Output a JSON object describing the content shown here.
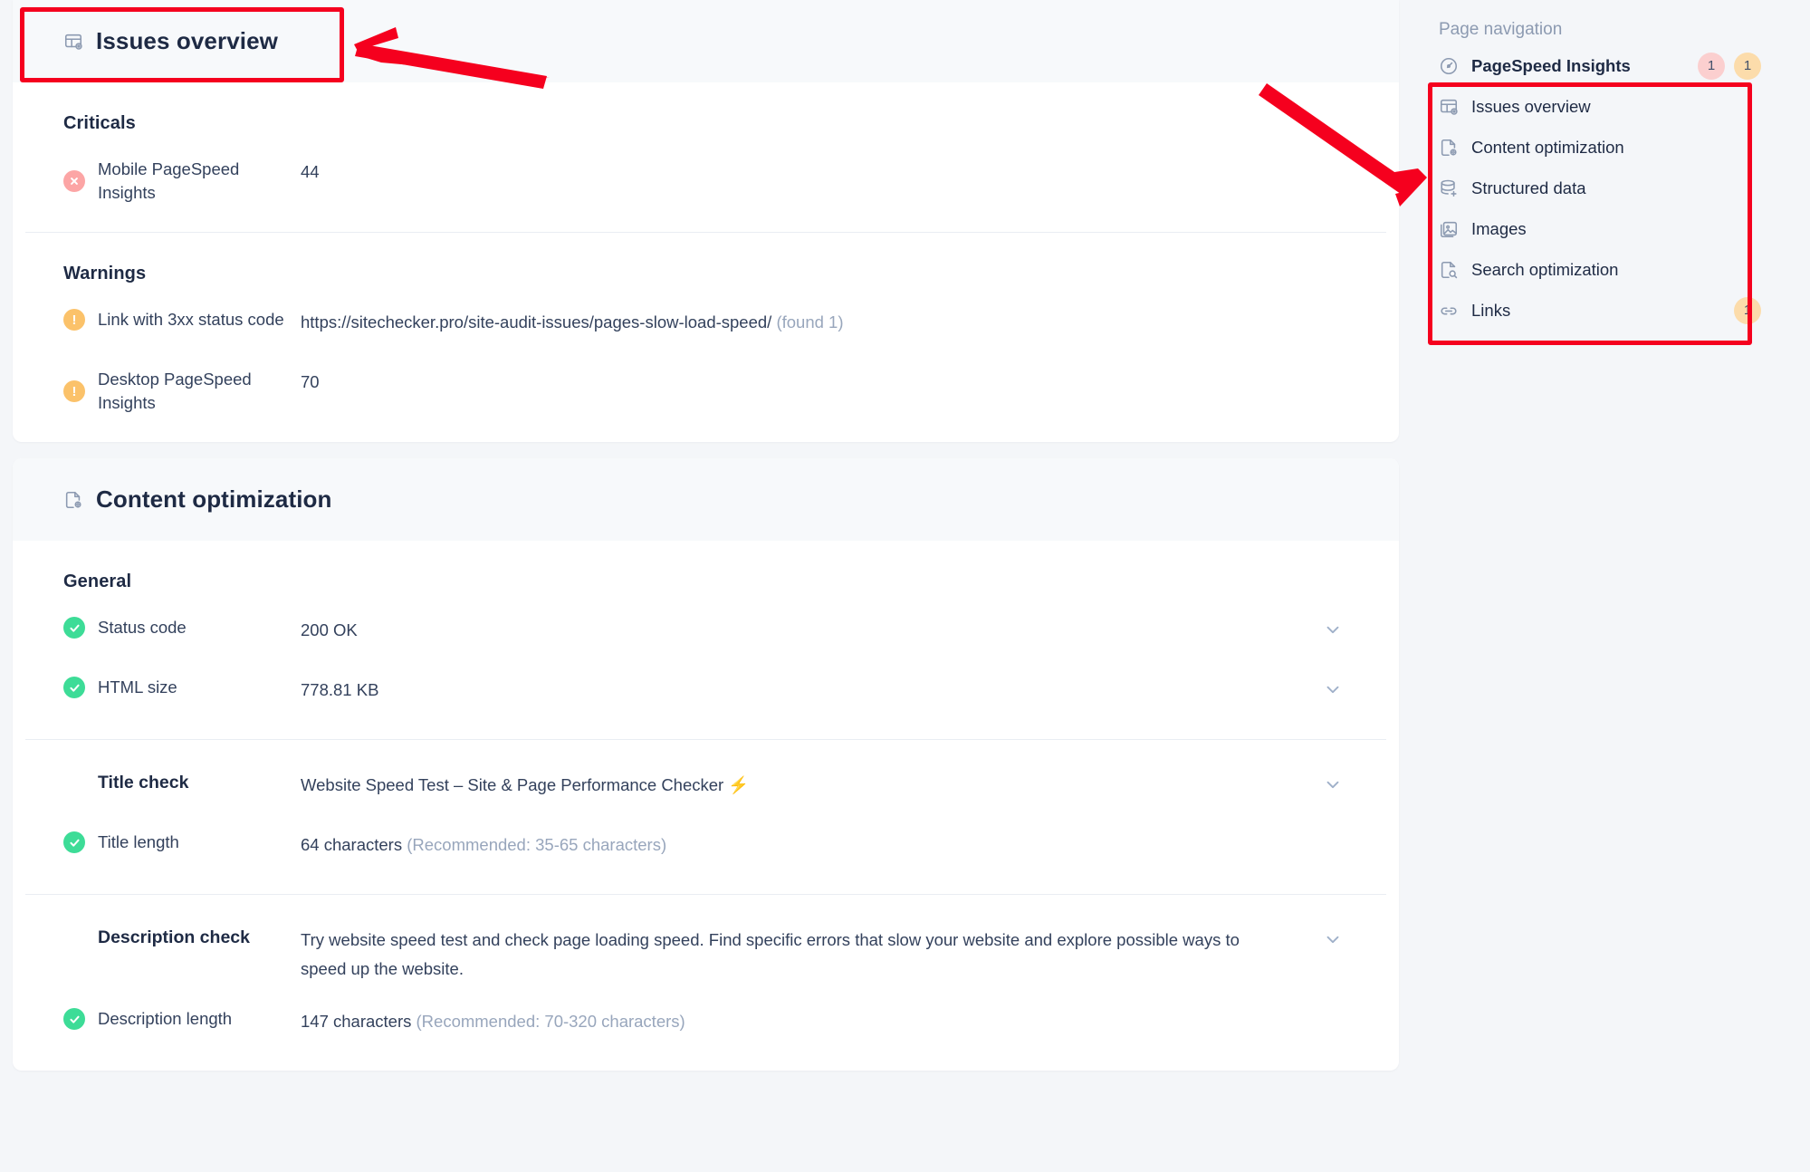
{
  "sections": [
    {
      "id": "issues-overview",
      "title": "Issues overview",
      "icon": "issues-overview-icon",
      "groups": [
        {
          "title": "Criticals",
          "rows": [
            {
              "status": "critical",
              "label": "Mobile PageSpeed Insights",
              "value": "44",
              "chevron": false
            }
          ]
        },
        {
          "title": "Warnings",
          "rows": [
            {
              "status": "warning",
              "label": "Link with 3xx status code",
              "value": "https://sitechecker.pro/site-audit-issues/pages-slow-load-speed/",
              "value_kind": "link",
              "suffix": "(found 1)",
              "chevron": false
            },
            {
              "status": "warning",
              "label": "Desktop PageSpeed Insights",
              "value": "70",
              "chevron": false
            }
          ]
        }
      ]
    },
    {
      "id": "content-optimization",
      "title": "Content optimization",
      "icon": "content-optimization-icon",
      "groups": [
        {
          "title": "General",
          "rows": [
            {
              "status": "ok",
              "label": "Status code",
              "value": "200 OK",
              "value_kind": "green",
              "chevron": true
            },
            {
              "status": "ok",
              "label": "HTML size",
              "value": "778.81 KB",
              "chevron": true
            }
          ]
        },
        {
          "title": null,
          "rows": [
            {
              "status": "none",
              "label": "Title check",
              "label_bold": true,
              "value": "Website Speed Test – Site & Page Performance Checker ⚡",
              "chevron": true
            },
            {
              "status": "ok",
              "label": "Title length",
              "value": "64 characters",
              "suffix": "(Recommended: 35-65 characters)",
              "chevron": false
            }
          ]
        },
        {
          "title": null,
          "rows": [
            {
              "status": "none",
              "label": "Description check",
              "label_bold": true,
              "value": "Try website speed test and check page loading speed. Find specific errors that slow your website and explore possible ways to speed up the website.",
              "chevron": true
            },
            {
              "status": "ok",
              "label": "Description length",
              "value": "147 characters",
              "suffix": "(Recommended: 70-320 characters)",
              "chevron": false
            }
          ]
        }
      ]
    }
  ],
  "sidebar": {
    "title": "Page navigation",
    "items": [
      {
        "label": "PageSpeed Insights",
        "icon": "speedometer-icon",
        "badges": [
          {
            "value": "1",
            "tone": "red"
          },
          {
            "value": "1",
            "tone": "amber"
          }
        ],
        "is_head": true
      },
      {
        "label": "Issues overview",
        "icon": "issues-overview-icon",
        "badges": []
      },
      {
        "label": "Content optimization",
        "icon": "content-optimization-icon",
        "badges": []
      },
      {
        "label": "Structured data",
        "icon": "database-icon",
        "badges": []
      },
      {
        "label": "Images",
        "icon": "image-icon",
        "badges": []
      },
      {
        "label": "Search optimization",
        "icon": "search-doc-icon",
        "badges": []
      },
      {
        "label": "Links",
        "icon": "link-icon",
        "badges": [
          {
            "value": "1",
            "tone": "amber"
          }
        ]
      }
    ]
  },
  "annotations": {
    "highlight_color": "#f5001e",
    "boxes": [
      "issues-overview-header",
      "page-navigation-list"
    ],
    "arrows": [
      "arrow-to-issues-overview-header",
      "arrow-to-page-navigation-list"
    ]
  },
  "colors": {
    "critical": "#fca5a5",
    "warning": "#fbc26a",
    "ok": "#3ddc97",
    "link": "#3b82f6",
    "text": "#1e2a44",
    "muted": "#98a6bc",
    "page_bg": "#f4f6f9"
  }
}
